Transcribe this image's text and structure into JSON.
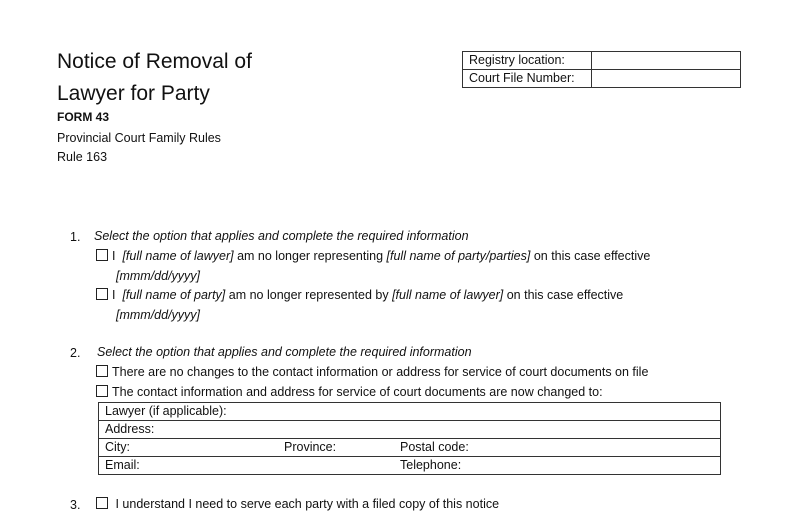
{
  "header": {
    "title_line1": "Notice of Removal of",
    "title_line2": "Lawyer for Party",
    "form_number": "FORM 43",
    "rules_name": "Provincial Court Family Rules",
    "rule_number": "Rule 163"
  },
  "registry": {
    "location_label": "Registry location:",
    "location_value": "",
    "file_number_label": "Court File Number:",
    "file_number_value": ""
  },
  "section1": {
    "number": "1.",
    "instruction": "Select the option that applies and complete the required information",
    "opt1": {
      "prefix": "I",
      "lawyer_ph": "[full name of lawyer]",
      "mid": "am no longer representing",
      "party_ph": "[full name of party/parties]",
      "suffix": "on this case effective",
      "date_ph": "[mmm/dd/yyyy]"
    },
    "opt2": {
      "prefix": "I",
      "party_ph": "[full name of party]",
      "mid": "am no longer represented by",
      "lawyer_ph": "[full name of lawyer]",
      "suffix": "on this case effective",
      "date_ph": "[mmm/dd/yyyy]"
    }
  },
  "section2": {
    "number": "2.",
    "instruction": "Select the option that applies and complete the required information",
    "opt1": "There are no changes to the contact information or address for service of court documents on file",
    "opt2": "The contact information and address for service of court documents are now changed to:",
    "table": {
      "lawyer_label": "Lawyer (if applicable):",
      "address_label": "Address:",
      "city_label": "City:",
      "province_label": "Province:",
      "postal_label": "Postal code:",
      "email_label": "Email:",
      "telephone_label": "Telephone:"
    }
  },
  "section3": {
    "number": "3.",
    "text": "I understand I need to serve each party with a filed copy of this notice"
  }
}
